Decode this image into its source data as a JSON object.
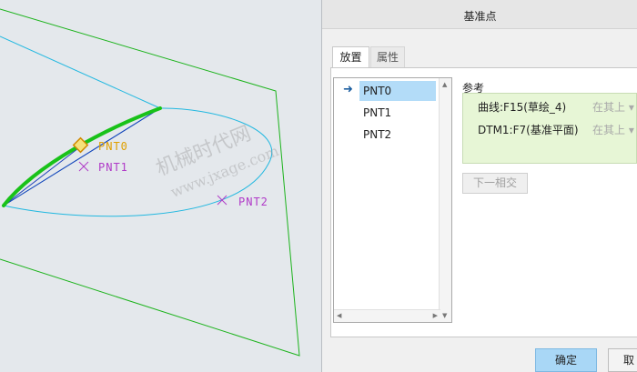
{
  "viewport": {
    "point_labels": [
      "PNT0",
      "PNT1",
      "PNT2"
    ],
    "watermark_cn": "机械时代网",
    "watermark_url": "www.jxage.com"
  },
  "dialog": {
    "title": "基准点",
    "tabs": [
      "放置",
      "属性"
    ],
    "points": [
      "PNT0",
      "PNT1",
      "PNT2"
    ],
    "selected_point": "PNT0",
    "references_label": "参考",
    "references": [
      {
        "name": "曲线:F15(草绘_4)",
        "constraint": "在其上"
      },
      {
        "name": "DTM1:F7(基准平面)",
        "constraint": "在其上"
      }
    ],
    "next_button": "下一相交",
    "ok_button": "确定",
    "cancel_button": "取消"
  },
  "colors": {
    "plane_edge": "#1cb31c",
    "curve": "#22b8e0",
    "chord": "#1c3fb8",
    "highlight": "#19c219",
    "pnt0": "#e0a000",
    "pnt_other": "#b03ac8",
    "selection": "#b3dcf8",
    "ref_bg": "#e7f6d6",
    "ok_bg": "#a9d7f6"
  }
}
